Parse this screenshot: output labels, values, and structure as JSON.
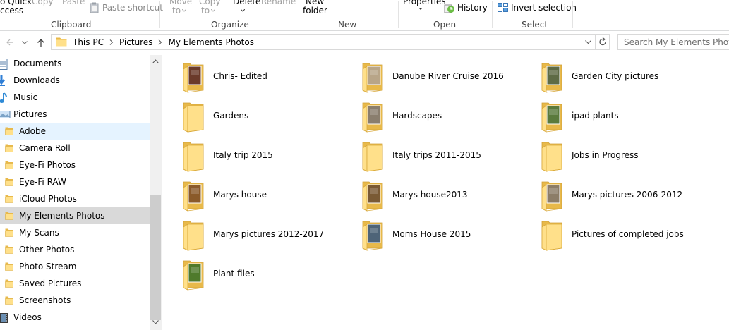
{
  "ribbon": {
    "clipboard": {
      "quick_access_line1": "o Quick",
      "quick_access_line2": "ccess",
      "copy": "Copy",
      "paste": "Paste",
      "paste_shortcut": "Paste shortcut",
      "label": "Clipboard"
    },
    "organize": {
      "move_to_line1": "Move",
      "move_to_line2": "to",
      "copy_to_line1": "Copy",
      "copy_to_line2": "to",
      "delete": "Delete",
      "rename": "Rename",
      "label": "Organize"
    },
    "new": {
      "new_folder_line1": "New",
      "new_folder_line2": "folder",
      "label": "New"
    },
    "open": {
      "properties": "Properties",
      "history": "History",
      "label": "Open"
    },
    "select": {
      "invert_selection": "Invert selection",
      "label": "Select"
    }
  },
  "address": {
    "crumbs": [
      "This PC",
      "Pictures",
      "My Elements Photos"
    ],
    "search_placeholder": "Search My Elements Photos"
  },
  "nav": {
    "items": [
      {
        "label": "Documents",
        "icon": "documents-icon"
      },
      {
        "label": "Downloads",
        "icon": "downloads-icon"
      },
      {
        "label": "Music",
        "icon": "music-icon"
      },
      {
        "label": "Pictures",
        "icon": "pictures-icon"
      },
      {
        "label": "Adobe",
        "icon": "folder-icon",
        "state": "hover"
      },
      {
        "label": "Camera Roll",
        "icon": "folder-icon"
      },
      {
        "label": "Eye-Fi Photos",
        "icon": "folder-icon"
      },
      {
        "label": "Eye-Fi RAW",
        "icon": "folder-icon"
      },
      {
        "label": "iCloud Photos",
        "icon": "folder-icon"
      },
      {
        "label": "My Elements Photos",
        "icon": "folder-icon",
        "state": "selected"
      },
      {
        "label": "My Scans",
        "icon": "folder-icon"
      },
      {
        "label": "Other Photos",
        "icon": "folder-icon"
      },
      {
        "label": "Photo Stream",
        "icon": "folder-icon"
      },
      {
        "label": "Saved Pictures",
        "icon": "folder-icon"
      },
      {
        "label": "Screenshots",
        "icon": "folder-icon"
      },
      {
        "label": "Videos",
        "icon": "videos-icon"
      }
    ]
  },
  "folders": [
    {
      "name": "Chris- Edited",
      "thumb": "#6b3b2a"
    },
    {
      "name": "Danube River Cruise 2016",
      "thumb": "#b8a588"
    },
    {
      "name": "Garden City pictures",
      "thumb": "#5e6b45"
    },
    {
      "name": "Gardens",
      "thumb": ""
    },
    {
      "name": "Hardscapes",
      "thumb": "#8a7e6e"
    },
    {
      "name": "ipad plants",
      "thumb": "#5a7a3c"
    },
    {
      "name": "Italy trip 2015",
      "thumb": ""
    },
    {
      "name": "Italy trips 2011-2015",
      "thumb": ""
    },
    {
      "name": "Jobs in Progress",
      "thumb": ""
    },
    {
      "name": "Marys house",
      "thumb": "#8a5a2a"
    },
    {
      "name": "Marys house2013",
      "thumb": "#7a5a35"
    },
    {
      "name": "Marys pictures 2006-2012",
      "thumb": "#8c7d68"
    },
    {
      "name": "Marys pictures 2012-2017",
      "thumb": ""
    },
    {
      "name": "Moms House 2015",
      "thumb": "#4e6478"
    },
    {
      "name": "Pictures of completed jobs",
      "thumb": ""
    },
    {
      "name": "Plant files",
      "thumb": "#4f7a2c"
    }
  ],
  "colors": {
    "folder_back": "#e8b94a",
    "folder_front": "#ffe08a",
    "selected_bg": "#d9d9d9",
    "hover_bg": "#e5f3ff",
    "ribbon_dim_text": "#a0a0a0"
  }
}
